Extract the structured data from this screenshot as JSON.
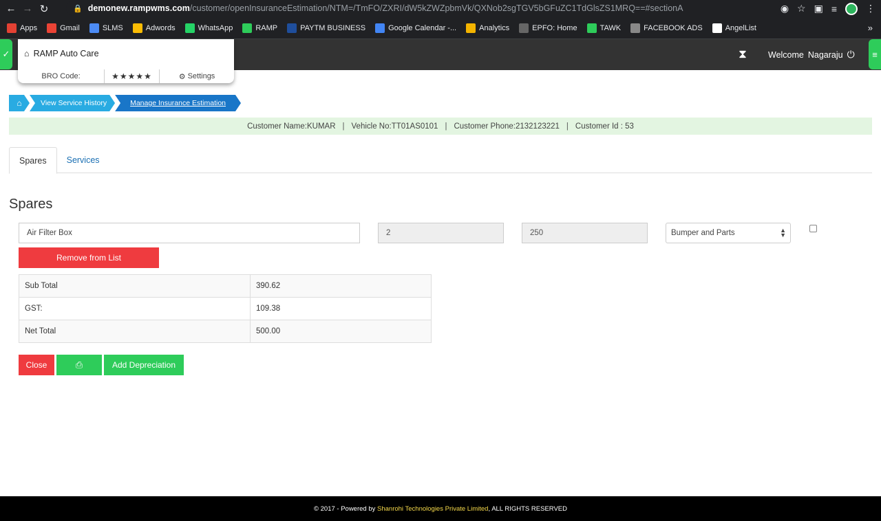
{
  "browser": {
    "url_domain": "demonew.rampwms.com",
    "url_path": "/customer/openInsuranceEstimation/NTM=/TmFO/ZXRI/dW5kZWZpbmVk/QXNob2sgTGV5bGFuZC1TdGlsZS1MRQ==#sectionA",
    "bookmarks": [
      "Apps",
      "Gmail",
      "SLMS",
      "Adwords",
      "WhatsApp",
      "RAMP",
      "PAYTM BUSINESS",
      "Google Calendar -...",
      "Analytics",
      "EPFO: Home",
      "TAWK",
      "FACEBOOK ADS",
      "AngelList"
    ],
    "bookmark_colors": [
      "#e34133",
      "#ea4335",
      "#4c8bf5",
      "#fbbc04",
      "#25d366",
      "#2ecc5a",
      "#1f4e9c",
      "#4285f4",
      "#f4b400",
      "#666666",
      "#2ecc5a",
      "#888888",
      "#ffffff"
    ]
  },
  "app": {
    "brand_name": "RAMP Auto Care",
    "bro_code_label": "BRO Code:",
    "rating_stars": "★★★★★",
    "settings_label": "Settings",
    "welcome_label": "Welcome",
    "user_name": "Nagaraju"
  },
  "breadcrumb": {
    "view_label": "View Service History",
    "manage_label": "Manage Insurance Estimation"
  },
  "customer": {
    "name": "Customer Name:KUMAR",
    "vehicle": "Vehicle No:TT01AS0101",
    "phone": "Customer Phone:2132123221",
    "id": "Customer Id : 53",
    "separator": "|"
  },
  "tabs": [
    "Spares",
    "Services"
  ],
  "section_title": "Spares",
  "spare_row": {
    "name": "Air Filter Box",
    "quantity": "2",
    "price": "250",
    "category": "Bumper and Parts",
    "remove_label": "Remove from List"
  },
  "totals": [
    {
      "label": "Sub Total",
      "value": "390.62"
    },
    {
      "label": "GST:",
      "value": "109.38"
    },
    {
      "label": "Net Total",
      "value": "500.00"
    }
  ],
  "actions": {
    "close_label": "Close",
    "add_depreciation_label": "Add Depreciation"
  },
  "footer": {
    "prefix": "© 2017 - Powered by",
    "company": "Shanrohi Technologies Private Limited",
    "suffix": ", ALL RIGHTS RESERVED"
  },
  "colors": {
    "accent_green": "#2ecc5a",
    "danger_red": "#ef3b3f",
    "breadcrumb_blue": "#29abe2",
    "info_bar_bg": "#e3f5e1"
  }
}
